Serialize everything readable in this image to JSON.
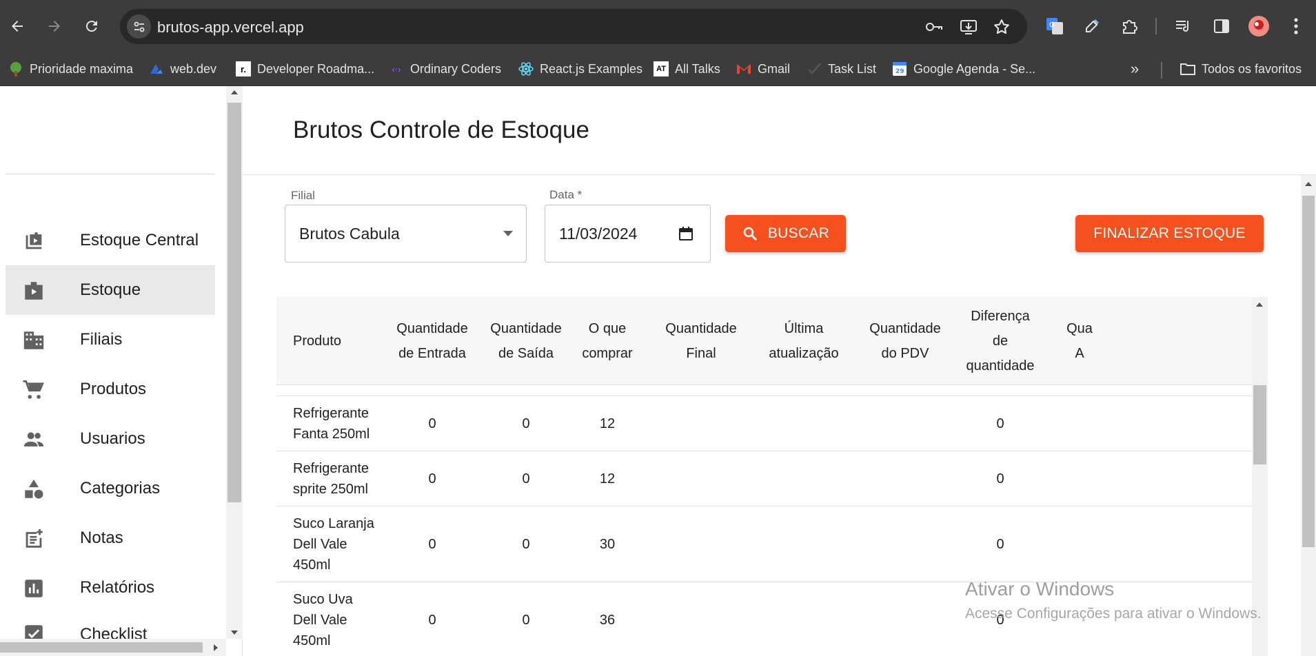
{
  "browser": {
    "url": "brutos-app.vercel.app",
    "bookmarks": [
      "Prioridade maxima",
      "web.dev",
      "Developer Roadma...",
      "Ordinary Coders",
      "React.js Examples",
      "All Talks",
      "Gmail",
      "Task List",
      "Google Agenda - Se..."
    ],
    "bookmark_all": "Todos os favoritos",
    "bookmark_at_label": "AT",
    "more_icon": "»"
  },
  "sidebar": {
    "items": [
      {
        "label": "Estoque Central",
        "icon": "inventory-icon"
      },
      {
        "label": "Estoque",
        "icon": "store-icon"
      },
      {
        "label": "Filiais",
        "icon": "building-icon"
      },
      {
        "label": "Produtos",
        "icon": "cart-icon"
      },
      {
        "label": "Usuarios",
        "icon": "people-icon"
      },
      {
        "label": "Categorias",
        "icon": "category-icon"
      },
      {
        "label": "Notas",
        "icon": "note-icon"
      },
      {
        "label": "Relatórios",
        "icon": "chart-icon"
      },
      {
        "label": "Checklist",
        "icon": "check-icon"
      }
    ],
    "active_index": 1
  },
  "header": {
    "title": "Brutos Controle de Estoque"
  },
  "form": {
    "filial_label": "Filial",
    "filial_value": "Brutos Cabula",
    "data_label": "Data *",
    "data_value": "11/03/2024",
    "buscar_label": "BUSCAR",
    "finalizar_label": "FINALIZAR ESTOQUE"
  },
  "table": {
    "columns": [
      "Produto",
      "Quantidade de Entrada",
      "Quantidade de Saída",
      "O que comprar",
      "Quantidade Final",
      "Última atualização",
      "Quantidade do PDV",
      "Diferença de quantidade",
      "Qua A"
    ],
    "header_lines": [
      [
        "Produto"
      ],
      [
        "Quantidade",
        "de Entrada"
      ],
      [
        "Quantidade",
        "de Saída"
      ],
      [
        "O que",
        "comprar"
      ],
      [
        "Quantidade",
        "Final"
      ],
      [
        "Última",
        "atualização"
      ],
      [
        "Quantidade",
        "do PDV"
      ],
      [
        "Diferença",
        "de",
        "quantidade"
      ],
      [
        "Qua",
        "A"
      ]
    ],
    "rows": [
      {
        "produto": [
          "Refrigerante",
          "Fanta 250ml"
        ],
        "entrada": "0",
        "saida": "0",
        "comprar": "12",
        "final": "",
        "atualizacao": "",
        "pdv": "",
        "diferenca": "0"
      },
      {
        "produto": [
          "Refrigerante",
          "sprite 250ml"
        ],
        "entrada": "0",
        "saida": "0",
        "comprar": "12",
        "final": "",
        "atualizacao": "",
        "pdv": "",
        "diferenca": "0"
      },
      {
        "produto": [
          "Suco Laranja",
          "Dell Vale",
          "450ml"
        ],
        "entrada": "0",
        "saida": "0",
        "comprar": "30",
        "final": "",
        "atualizacao": "",
        "pdv": "",
        "diferenca": "0"
      },
      {
        "produto": [
          "Suco Uva",
          "Dell Vale",
          "450ml"
        ],
        "entrada": "0",
        "saida": "0",
        "comprar": "36",
        "final": "",
        "atualizacao": "",
        "pdv": "",
        "diferenca": "0"
      }
    ]
  },
  "watermark": {
    "line1": "Ativar o Windows",
    "line2": "Acesse Configurações para ativar o Windows."
  },
  "colors": {
    "accent": "#f5511e",
    "chrome": "#3c3c3c",
    "active": "#e9e9e9"
  }
}
